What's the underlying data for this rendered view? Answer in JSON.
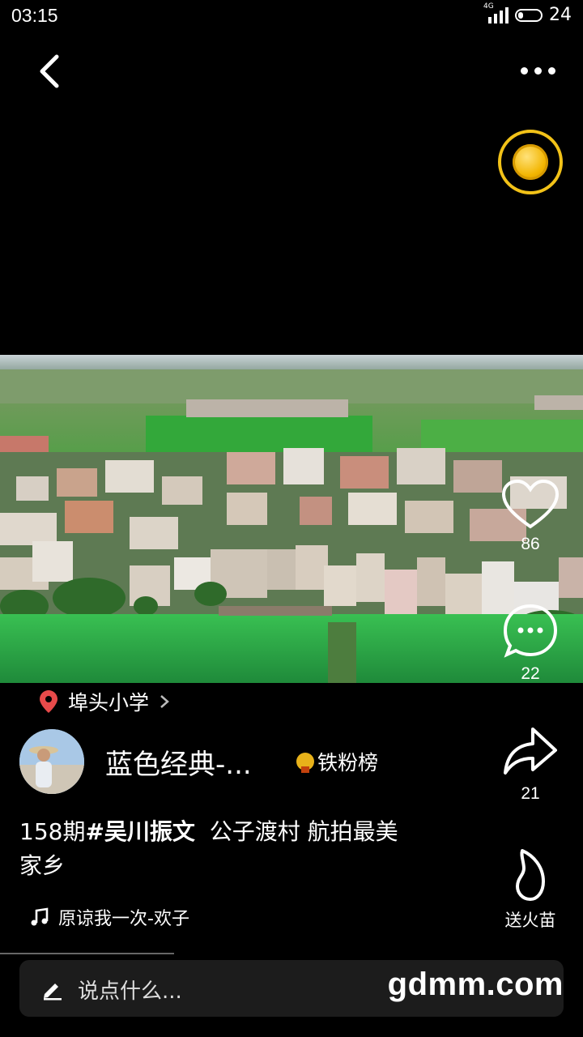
{
  "status_bar": {
    "time": "03:15",
    "network": "4G",
    "battery": "24"
  },
  "top": {
    "back_icon": "chevron-left-icon",
    "more_icon": "more-dots-icon",
    "coin_icon": "gold-coin-icon"
  },
  "side_actions": {
    "like_count": "86",
    "comment_count": "22",
    "share_count": "21",
    "gift_label": "送火苗"
  },
  "post": {
    "location": "埠头小学",
    "author_name": "蓝色经典-...",
    "badge": "铁粉榜",
    "caption_prefix": "158期",
    "caption_tag": "#吴川振文",
    "caption_line1_rest": "  公子渡村 航拍最美",
    "caption_line2": "家乡",
    "music": "原谅我一次-欢子"
  },
  "comment_input": {
    "placeholder": "说点什么..."
  },
  "watermark": "gdmm.com",
  "colors": {
    "coin_ring": "#f2c218",
    "location_pin": "#e84a4a"
  }
}
